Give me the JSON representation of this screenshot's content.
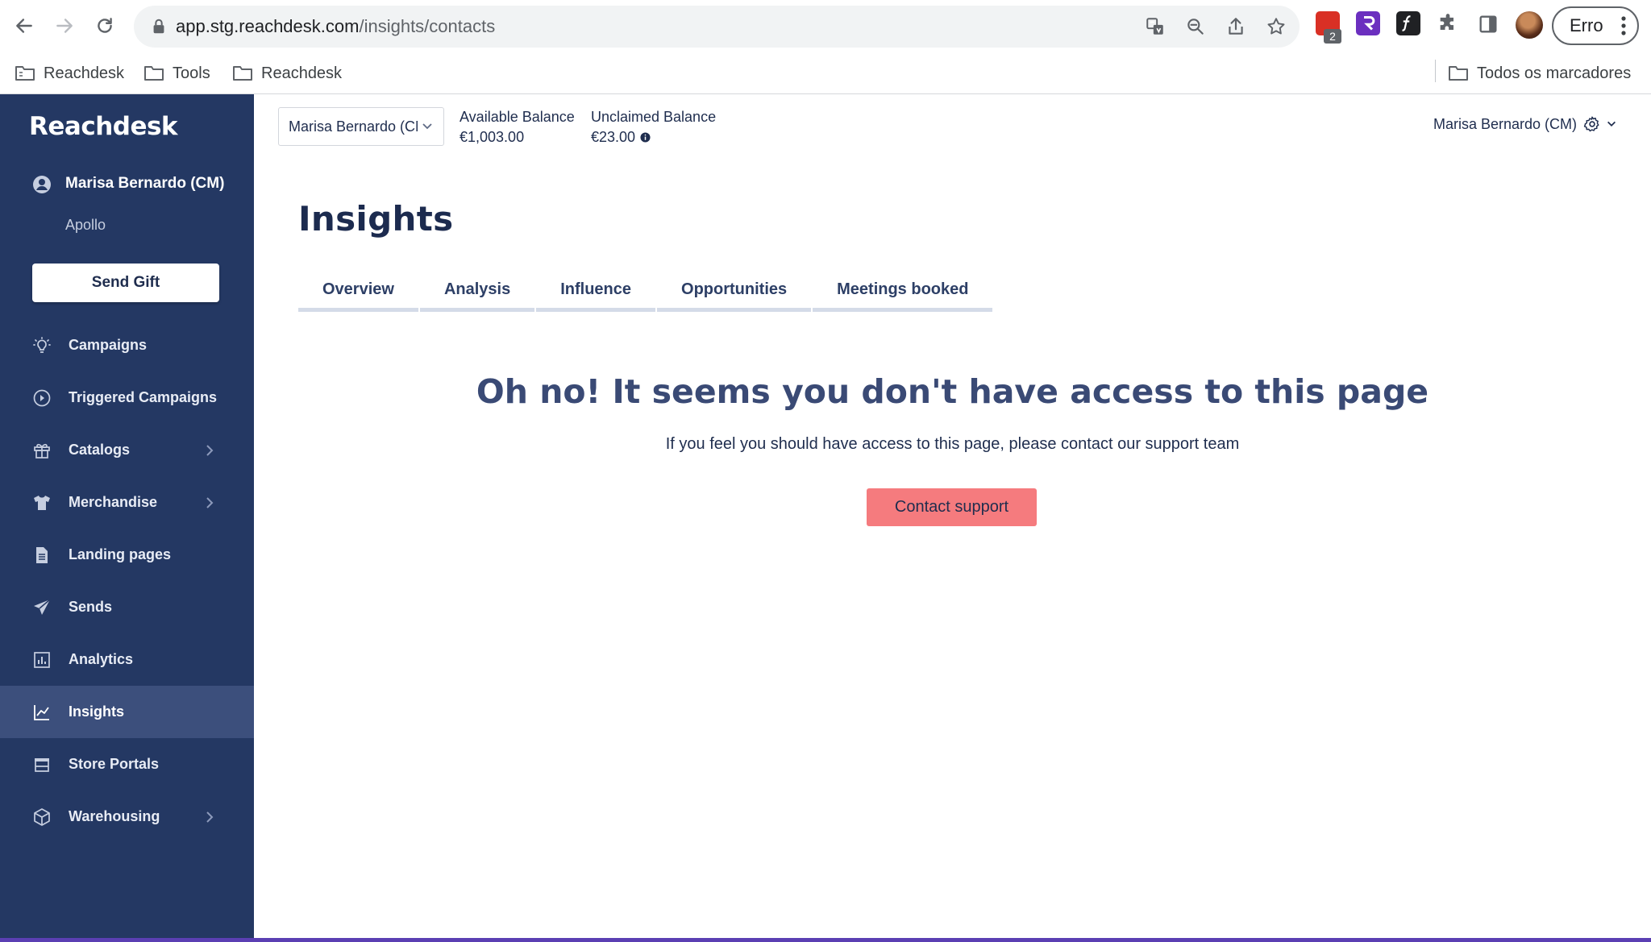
{
  "browser": {
    "url_host": "app.stg.reachdesk.com",
    "url_path": "/insights/contacts",
    "extension_badge": "2",
    "error_chip_label": "Erro",
    "bookmarks": [
      "Reachdesk",
      "Tools",
      "Reachdesk"
    ],
    "all_bookmarks_label": "Todos os marcadores"
  },
  "sidebar": {
    "logo": "Reachdesk",
    "user_name": "Marisa Bernardo (CM)",
    "user_org": "Apollo",
    "send_gift_label": "Send Gift",
    "items": [
      {
        "label": "Campaigns",
        "icon": "lightbulb-icon"
      },
      {
        "label": "Triggered Campaigns",
        "icon": "play-circle-icon"
      },
      {
        "label": "Catalogs",
        "icon": "gift-icon",
        "has_submenu": true
      },
      {
        "label": "Merchandise",
        "icon": "tshirt-icon",
        "has_submenu": true
      },
      {
        "label": "Landing pages",
        "icon": "document-icon"
      },
      {
        "label": "Sends",
        "icon": "paper-plane-icon"
      },
      {
        "label": "Analytics",
        "icon": "bar-chart-icon"
      },
      {
        "label": "Insights",
        "icon": "line-chart-icon",
        "active": true
      },
      {
        "label": "Store Portals",
        "icon": "store-icon"
      },
      {
        "label": "Warehousing",
        "icon": "box-icon",
        "has_submenu": true
      }
    ]
  },
  "header": {
    "account_select_value": "Marisa Bernardo (CM)",
    "available_balance_label": "Available Balance",
    "available_balance_value": "€1,003.00",
    "unclaimed_balance_label": "Unclaimed Balance",
    "unclaimed_balance_value": "€23.00",
    "user_menu_label": "Marisa Bernardo (CM)"
  },
  "main": {
    "title": "Insights",
    "tabs": [
      "Overview",
      "Analysis",
      "Influence",
      "Opportunities",
      "Meetings booked"
    ],
    "no_access_title": "Oh no! It seems you don't have access to this page",
    "no_access_message": "If you feel you should have access to this page, please contact our support team",
    "contact_button_label": "Contact support"
  },
  "colors": {
    "sidebar_bg": "#243863",
    "sidebar_active": "#3c4f7c",
    "contact_button": "#f57b7e",
    "title_text": "#1c2b4f"
  }
}
